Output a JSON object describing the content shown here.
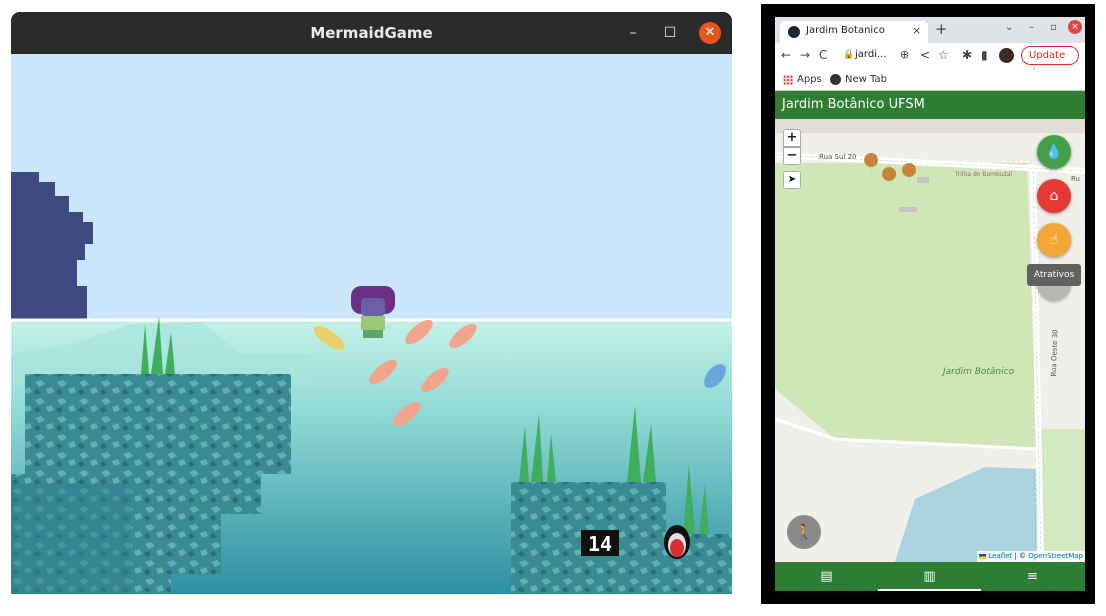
{
  "game_window": {
    "title": "MermaidGame",
    "controls": {
      "minimize": "–",
      "maximize": "☐",
      "close": "✕"
    },
    "hud": {
      "score": "14"
    }
  },
  "browser": {
    "tab": {
      "title": "Jardim Botanico",
      "close": "×"
    },
    "new_tab": "+",
    "window_controls": {
      "menu": "⌄",
      "minimize": "–",
      "maximize": "▫",
      "close": "×"
    },
    "toolbar": {
      "back": "←",
      "forward": "→",
      "reload": "C",
      "lock": "🔒",
      "url": "jardi...",
      "install": "⊕",
      "share": "<",
      "star": "☆",
      "extensions": "✱",
      "sidebar": "▮",
      "update_label": "Update ⋮"
    },
    "bookmarks": [
      {
        "label": "Apps",
        "icon": "apps-grid-icon"
      },
      {
        "label": "New Tab",
        "icon": "chrome-icon"
      }
    ]
  },
  "app": {
    "title": "Jardim Botânico UFSM",
    "map": {
      "zoom_in": "+",
      "zoom_out": "−",
      "locate": "➤",
      "labels": {
        "street_south": "Rua Sul 20",
        "street_west": "Rua Oeste 30",
        "trail": "Trilha do Bambuzal",
        "area": "Jardim Botânico",
        "street_partial": "Ru"
      },
      "attribution": {
        "leaflet": "Leaflet",
        "separator": " | © ",
        "osm": "OpenStreetMap"
      }
    },
    "fabs": {
      "nature": "💧",
      "home": "⌂",
      "attractions": "☝",
      "walk": "🚶"
    },
    "tooltip": "Atrativos",
    "bottom_nav": [
      {
        "icon": "inbox-icon",
        "glyph": "▤"
      },
      {
        "icon": "map-icon",
        "glyph": "▥"
      },
      {
        "icon": "menu-icon",
        "glyph": "≡"
      }
    ]
  },
  "colors": {
    "sky": "#c9e6fa",
    "water_top": "#bff0e8",
    "water_bottom": "#2f8ea1",
    "rock": "#3f8f99",
    "app_green": "#2e7d32",
    "fab_green": "#43a047",
    "fab_red": "#e53935",
    "fab_orange": "#f4a636",
    "park_green": "#cfe6b6"
  }
}
